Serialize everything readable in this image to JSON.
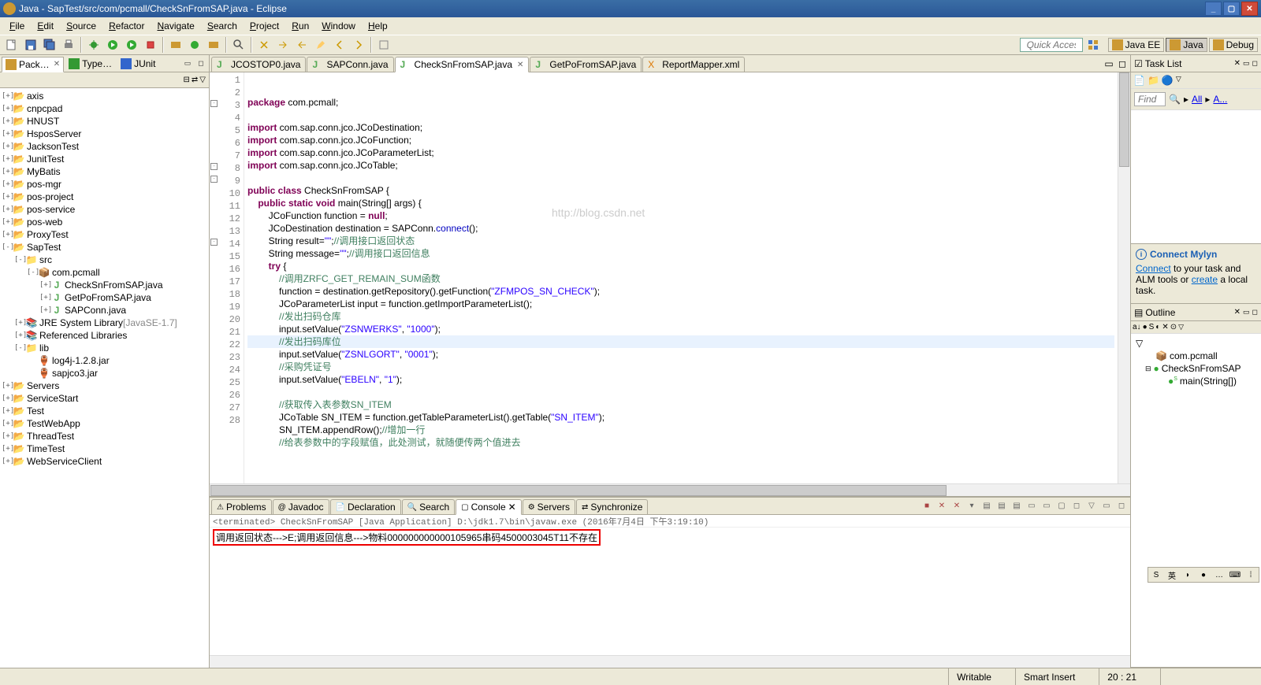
{
  "title": "Java - SapTest/src/com/pcmall/CheckSnFromSAP.java - Eclipse",
  "menu": [
    "File",
    "Edit",
    "Source",
    "Refactor",
    "Navigate",
    "Search",
    "Project",
    "Run",
    "Window",
    "Help"
  ],
  "quick_access": "Quick Access",
  "perspectives": [
    {
      "label": "Java EE",
      "icon": "javaee-icon"
    },
    {
      "label": "Java",
      "icon": "java-icon",
      "selected": true
    },
    {
      "label": "Debug",
      "icon": "debug-icon"
    }
  ],
  "left_views": [
    {
      "label": "Pack…",
      "active": true,
      "closeable": true
    },
    {
      "label": "Type…"
    },
    {
      "label": "JUnit"
    }
  ],
  "package_tree": [
    {
      "d": 0,
      "t": "+",
      "i": "prj",
      "l": "axis"
    },
    {
      "d": 0,
      "t": "+",
      "i": "prj",
      "l": "cnpcpad"
    },
    {
      "d": 0,
      "t": "+",
      "i": "prj",
      "l": "HNUST"
    },
    {
      "d": 0,
      "t": "+",
      "i": "prj",
      "l": "HsposServer"
    },
    {
      "d": 0,
      "t": "+",
      "i": "prj",
      "l": "JacksonTest"
    },
    {
      "d": 0,
      "t": "+",
      "i": "prj",
      "l": "JunitTest"
    },
    {
      "d": 0,
      "t": "+",
      "i": "prj",
      "l": "MyBatis"
    },
    {
      "d": 0,
      "t": "+",
      "i": "prj",
      "l": "pos-mgr"
    },
    {
      "d": 0,
      "t": "+",
      "i": "prj",
      "l": "pos-project"
    },
    {
      "d": 0,
      "t": "+",
      "i": "prj",
      "l": "pos-service"
    },
    {
      "d": 0,
      "t": "+",
      "i": "prj",
      "l": "pos-web"
    },
    {
      "d": 0,
      "t": "+",
      "i": "prj",
      "l": "ProxyTest"
    },
    {
      "d": 0,
      "t": "-",
      "i": "prj",
      "l": "SapTest"
    },
    {
      "d": 1,
      "t": "-",
      "i": "fld",
      "l": "src"
    },
    {
      "d": 2,
      "t": "-",
      "i": "pkg",
      "l": "com.pcmall"
    },
    {
      "d": 3,
      "t": "+",
      "i": "java",
      "l": "CheckSnFromSAP.java"
    },
    {
      "d": 3,
      "t": "+",
      "i": "java",
      "l": "GetPoFromSAP.java"
    },
    {
      "d": 3,
      "t": "+",
      "i": "java",
      "l": "SAPConn.java"
    },
    {
      "d": 1,
      "t": "+",
      "i": "lib",
      "l": "JRE System Library",
      "suffix": "[JavaSE-1.7]"
    },
    {
      "d": 1,
      "t": "+",
      "i": "lib",
      "l": "Referenced Libraries"
    },
    {
      "d": 1,
      "t": "-",
      "i": "fld",
      "l": "lib"
    },
    {
      "d": 2,
      "t": " ",
      "i": "jar",
      "l": "log4j-1.2.8.jar"
    },
    {
      "d": 2,
      "t": " ",
      "i": "jar",
      "l": "sapjco3.jar"
    },
    {
      "d": 0,
      "t": "+",
      "i": "prj",
      "l": "Servers"
    },
    {
      "d": 0,
      "t": "+",
      "i": "prj",
      "l": "ServiceStart"
    },
    {
      "d": 0,
      "t": "+",
      "i": "prj",
      "l": "Test"
    },
    {
      "d": 0,
      "t": "+",
      "i": "prj",
      "l": "TestWebApp"
    },
    {
      "d": 0,
      "t": "+",
      "i": "prj",
      "l": "ThreadTest"
    },
    {
      "d": 0,
      "t": "+",
      "i": "prj",
      "l": "TimeTest"
    },
    {
      "d": 0,
      "t": "+",
      "i": "prj",
      "l": "WebServiceClient"
    }
  ],
  "editor_tabs": [
    {
      "label": "JCOSTOP0.java",
      "icon": "java"
    },
    {
      "label": "SAPConn.java",
      "icon": "java"
    },
    {
      "label": "CheckSnFromSAP.java",
      "icon": "java",
      "active": true,
      "closeable": true
    },
    {
      "label": "GetPoFromSAP.java",
      "icon": "java"
    },
    {
      "label": "ReportMapper.xml",
      "icon": "xml"
    }
  ],
  "code": [
    {
      "n": 1,
      "h": "<span class='kw'>package</span> com.pcmall;"
    },
    {
      "n": 2,
      "h": ""
    },
    {
      "n": 3,
      "h": "<span class='kw'>import</span> com.sap.conn.jco.JCoDestination;"
    },
    {
      "n": 4,
      "h": "<span class='kw'>import</span> com.sap.conn.jco.JCoFunction;"
    },
    {
      "n": 5,
      "h": "<span class='kw'>import</span> com.sap.conn.jco.JCoParameterList;"
    },
    {
      "n": 6,
      "h": "<span class='kw'>import</span> com.sap.conn.jco.JCoTable;"
    },
    {
      "n": 7,
      "h": ""
    },
    {
      "n": 8,
      "h": "<span class='kw'>public class</span> CheckSnFromSAP {"
    },
    {
      "n": 9,
      "h": "    <span class='kw'>public static void</span> main(String[] args) {"
    },
    {
      "n": 10,
      "h": "        JCoFunction function = <span class='kw'>null</span>;"
    },
    {
      "n": 11,
      "h": "        JCoDestination destination = SAPConn.<span class='fld'>connect</span>();"
    },
    {
      "n": 12,
      "h": "        String result=<span class='str'>\"\"</span>;<span class='cmt'>//调用接口返回状态</span>"
    },
    {
      "n": 13,
      "h": "        String message=<span class='str'>\"\"</span>;<span class='cmt'>//调用接口返回信息</span>"
    },
    {
      "n": 14,
      "h": "        <span class='kw'>try</span> {"
    },
    {
      "n": 15,
      "h": "            <span class='cmt'>//调用ZRFC_GET_REMAIN_SUM函数</span>"
    },
    {
      "n": 16,
      "h": "            function = destination.getRepository().getFunction(<span class='str'>\"ZFMPOS_SN_CHECK\"</span>);"
    },
    {
      "n": 17,
      "h": "            JCoParameterList input = function.getImportParameterList();"
    },
    {
      "n": 18,
      "h": "            <span class='cmt'>//发出扫码仓库</span>"
    },
    {
      "n": 19,
      "h": "            input.setValue(<span class='str'>\"ZSNWERKS\"</span>, <span class='str'>\"1000\"</span>);"
    },
    {
      "n": 20,
      "h": "            <span class='cmt'>//发出扫码库位</span>",
      "hl": true
    },
    {
      "n": 21,
      "h": "            input.setValue(<span class='str'>\"ZSNLGORT\"</span>, <span class='str'>\"0001\"</span>);"
    },
    {
      "n": 22,
      "h": "            <span class='cmt'>//采购凭证号</span>"
    },
    {
      "n": 23,
      "h": "            input.setValue(<span class='str'>\"EBELN\"</span>, <span class='str'>\"1\"</span>);"
    },
    {
      "n": 24,
      "h": ""
    },
    {
      "n": 25,
      "h": "            <span class='cmt'>//获取传入表参数SN_ITEM</span>"
    },
    {
      "n": 26,
      "h": "            JCoTable SN_ITEM = function.getTableParameterList().getTable(<span class='str'>\"SN_ITEM\"</span>);"
    },
    {
      "n": 27,
      "h": "            SN_ITEM.appendRow();<span class='cmt'>//增加一行</span>"
    },
    {
      "n": 28,
      "h": "            <span class='cmt'>//给表参数中的字段赋值，此处测试，就随便传两个值进去</span>"
    }
  ],
  "watermark": "http://blog.csdn.net",
  "bottom_tabs": [
    {
      "label": "Problems",
      "icon": "⚠"
    },
    {
      "label": "Javadoc",
      "icon": "@"
    },
    {
      "label": "Declaration",
      "icon": "📄"
    },
    {
      "label": "Search",
      "icon": "🔍"
    },
    {
      "label": "Console",
      "icon": "▢",
      "active": true,
      "closeable": true
    },
    {
      "label": "Servers",
      "icon": "⚙"
    },
    {
      "label": "Synchronize",
      "icon": "⇄"
    }
  ],
  "console_header": "<terminated> CheckSnFromSAP [Java Application] D:\\jdk1.7\\bin\\javaw.exe (2016年7月4日 下午3:19:10)",
  "console_output": "调用返回状态--->E;调用返回信息--->物料000000000000105965串码4500003045T11不存在",
  "task_list": {
    "title": "Task List",
    "find_ph": "Find",
    "all_link": "All",
    "a_link": "A...",
    "mylyn_title": "Connect Mylyn",
    "mylyn_text1": "Connect",
    "mylyn_text2": " to your task and ALM tools or ",
    "mylyn_text3": "create",
    "mylyn_text4": " a local task."
  },
  "outline": {
    "title": "Outline",
    "items": [
      {
        "d": 0,
        "l": "com.pcmall",
        "i": "pkg"
      },
      {
        "d": 0,
        "l": "CheckSnFromSAP",
        "i": "class",
        "exp": true
      },
      {
        "d": 1,
        "l": "main(String[])",
        "i": "method"
      }
    ]
  },
  "status": {
    "writable": "Writable",
    "insert": "Smart Insert",
    "pos": "20 : 21"
  },
  "ime": [
    "S",
    "英",
    "◗",
    "●",
    "…",
    "⌨",
    "⁞"
  ]
}
